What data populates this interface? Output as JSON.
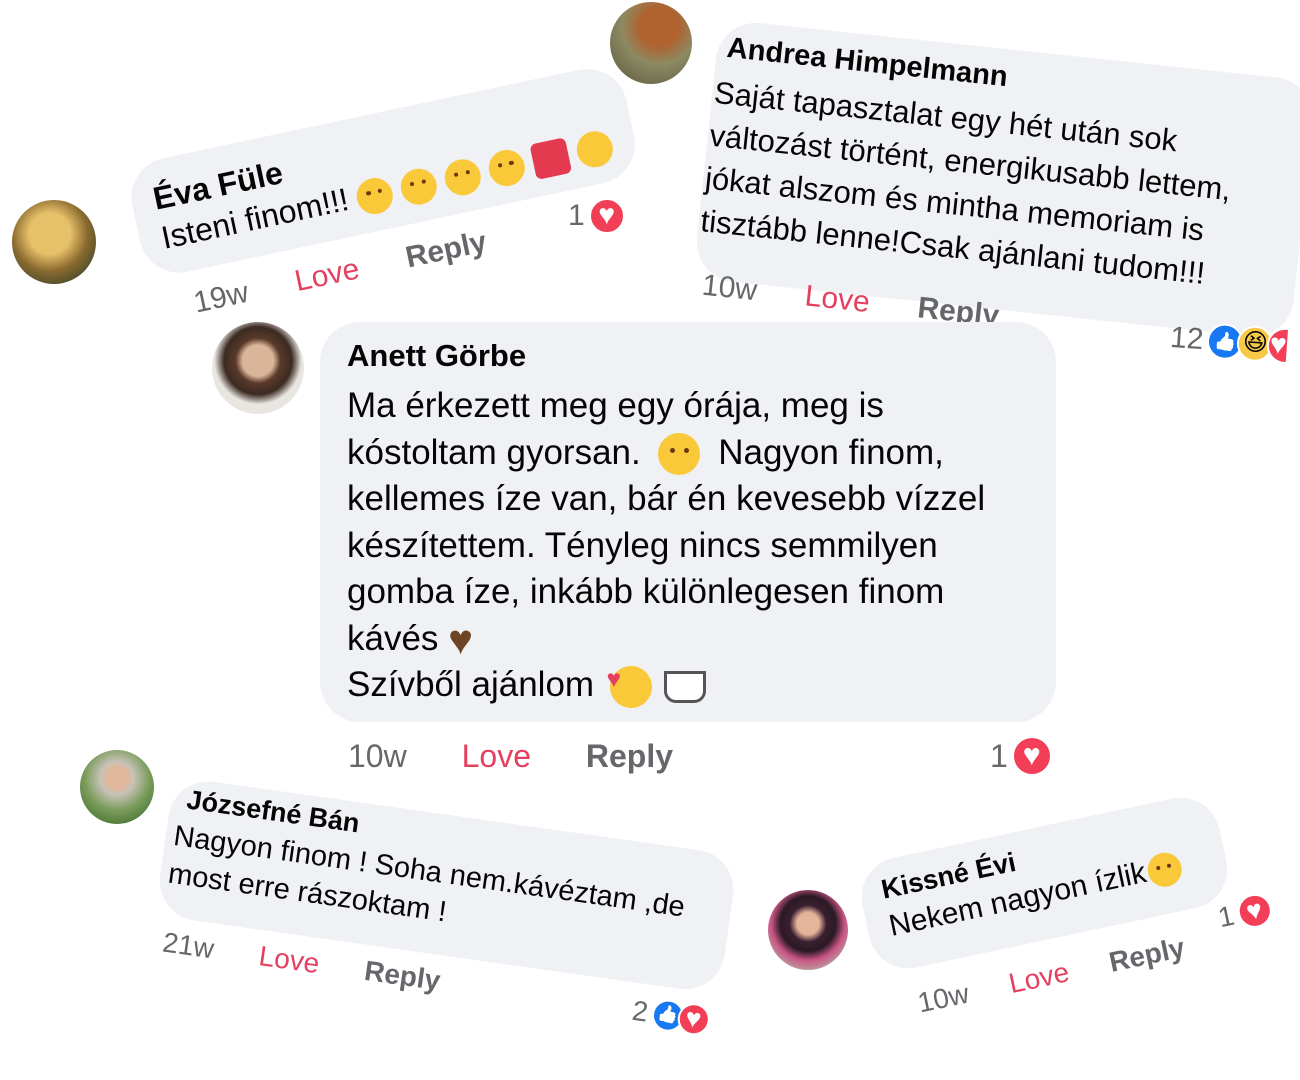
{
  "comments": [
    {
      "author": "Éva Füle",
      "lines": [
        "Isteni finom!!!"
      ],
      "emojis": [
        "savoring-face",
        "savoring-face",
        "savoring-face",
        "smiling-face",
        "heart-with-ribbon",
        "smiling-face-with-hands"
      ],
      "time": "19w",
      "love_label": "Love",
      "reply_label": "Reply",
      "reaction_count": "1",
      "reactions": [
        "love"
      ]
    },
    {
      "author": "Andrea Himpelmann",
      "lines": [
        "Saját tapasztalat egy hét után sok",
        "változást történt, energikusabb lettem,",
        "jókat alszom és mintha memoriam is",
        "tisztább lenne!Csak ajánlani tudom!!!"
      ],
      "time": "10w",
      "love_label": "Love",
      "reply_label": "Reply",
      "reaction_count": "12",
      "reactions": [
        "like",
        "haha",
        "love"
      ]
    },
    {
      "author": "Anett Görbe",
      "lines": [
        "Ma érkezett meg egy órája, meg is",
        "kóstoltam gyorsan.",
        "Nagyon finom,",
        "kellemes íze van, bár én kevesebb vízzel",
        "készítettem. Tényleg nincs semmilyen",
        "gomba íze, inkább különlegesen finom",
        "kávés",
        "Szívből ajánlom"
      ],
      "emojis": [
        "smiling-face",
        "brown-heart",
        "smiling-face-with-hearts",
        "hot-beverage"
      ],
      "time": "10w",
      "love_label": "Love",
      "reply_label": "Reply",
      "reaction_count": "1",
      "reactions": [
        "love"
      ]
    },
    {
      "author": "Józsefné Bán",
      "lines": [
        "Nagyon finom ! Soha nem.kávéztam ,de",
        "most erre rászoktam !"
      ],
      "time": "21w",
      "love_label": "Love",
      "reply_label": "Reply",
      "reaction_count": "2",
      "reactions": [
        "like",
        "love"
      ]
    },
    {
      "author": "Kissné Évi",
      "lines": [
        "Nekem nagyon ízlik"
      ],
      "emojis": [
        "grinning-face"
      ],
      "time": "10w",
      "love_label": "Love",
      "reply_label": "Reply",
      "reaction_count": "1",
      "reactions": [
        "love"
      ]
    }
  ],
  "colors": {
    "bubble": "#eff1f4",
    "love": "#e4405f",
    "meta": "#65676b",
    "like": "#1877f2"
  }
}
